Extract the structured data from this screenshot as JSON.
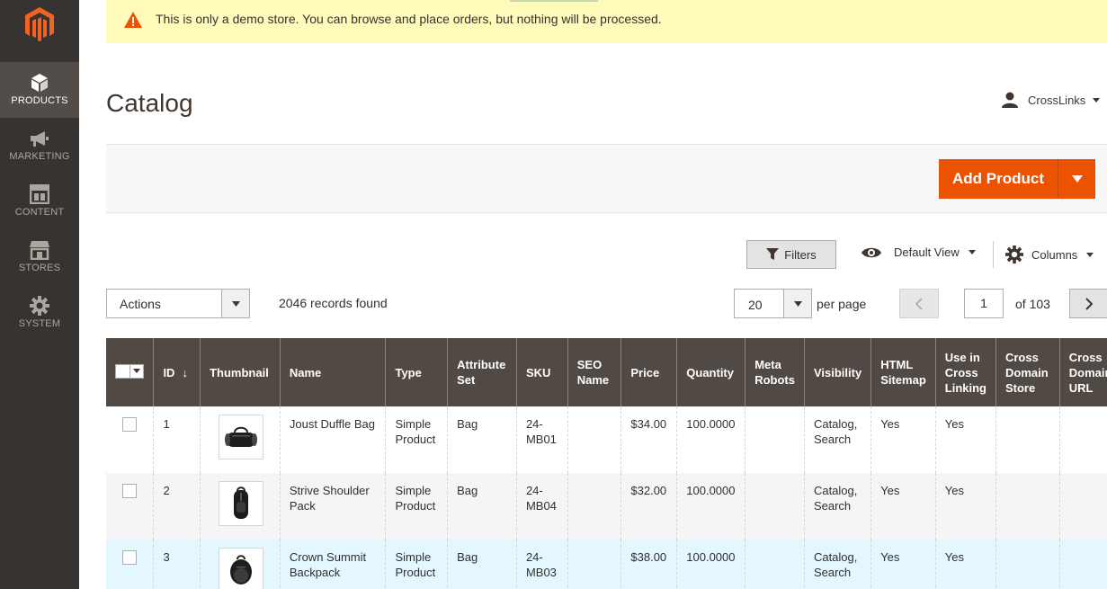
{
  "notice": {
    "message": "This is only a demo store. You can browse and place orders, but nothing will be processed.",
    "icon": "warning-icon"
  },
  "sidebar": {
    "items": [
      {
        "label": "PRODUCTS",
        "icon": "cube-icon",
        "active": true
      },
      {
        "label": "MARKETING",
        "icon": "megaphone-icon"
      },
      {
        "label": "CONTENT",
        "icon": "layout-icon"
      },
      {
        "label": "STORES",
        "icon": "store-icon"
      },
      {
        "label": "SYSTEM",
        "icon": "gear-icon"
      }
    ]
  },
  "header": {
    "title": "Catalog",
    "user": "CrossLinks"
  },
  "action_bar": {
    "add_label": "Add Product"
  },
  "toolbar": {
    "filters_label": "Filters",
    "view_label": "Default View",
    "columns_label": "Columns",
    "actions_label": "Actions",
    "records": "2046 records found",
    "per_page_value": "20",
    "per_page_label": "per page",
    "page_value": "1",
    "page_of": "of 103"
  },
  "grid": {
    "columns": [
      "ID",
      "Thumbnail",
      "Name",
      "Type",
      "Attribute Set",
      "SKU",
      "SEO Name",
      "Price",
      "Quantity",
      "Meta Robots",
      "Visibility",
      "HTML Sitemap",
      "Use in Cross Linking",
      "Cross Domain Store",
      "Cross Domain URL"
    ],
    "rows": [
      {
        "id": "1",
        "name": "Joust Duffle Bag",
        "type": "Simple Product",
        "attribute_set": "Bag",
        "sku": "24-MB01",
        "seo_name": "",
        "price": "$34.00",
        "quantity": "100.0000",
        "meta_robots": "",
        "visibility": "Catalog, Search",
        "html_sitemap": "Yes",
        "cross_linking": "Yes",
        "cross_store": "",
        "cross_url": ""
      },
      {
        "id": "2",
        "name": "Strive Shoulder Pack",
        "type": "Simple Product",
        "attribute_set": "Bag",
        "sku": "24-MB04",
        "seo_name": "",
        "price": "$32.00",
        "quantity": "100.0000",
        "meta_robots": "",
        "visibility": "Catalog, Search",
        "html_sitemap": "Yes",
        "cross_linking": "Yes",
        "cross_store": "",
        "cross_url": ""
      },
      {
        "id": "3",
        "name": "Crown Summit Backpack",
        "type": "Simple Product",
        "attribute_set": "Bag",
        "sku": "24-MB03",
        "seo_name": "",
        "price": "$38.00",
        "quantity": "100.0000",
        "meta_robots": "",
        "visibility": "Catalog, Search",
        "html_sitemap": "Yes",
        "cross_linking": "Yes",
        "cross_store": "",
        "cross_url": ""
      }
    ]
  },
  "colors": {
    "accent": "#eb5202",
    "sidebar": "#373330",
    "header_row": "#514943"
  }
}
